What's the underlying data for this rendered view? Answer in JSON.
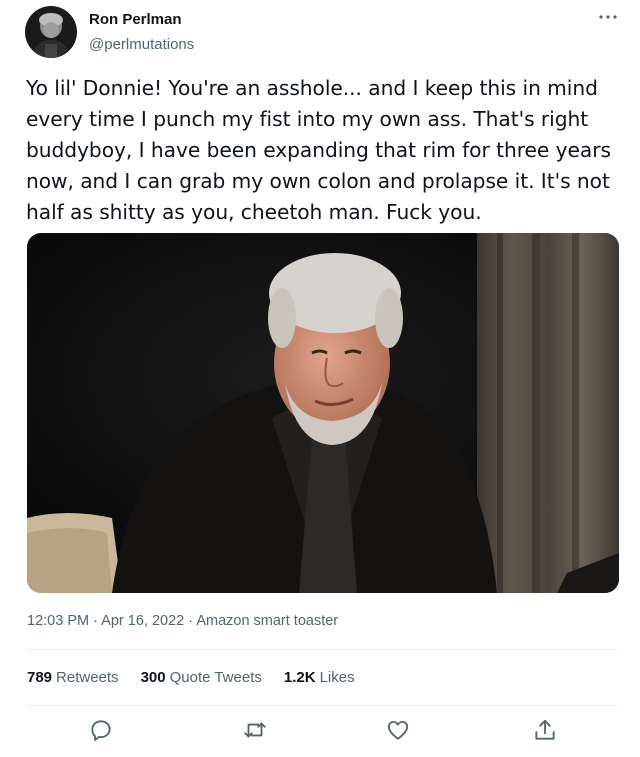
{
  "author": {
    "display_name": "Ron Perlman",
    "handle": "@perlmutations"
  },
  "tweet": {
    "text": "Yo lil' Donnie! You're an asshole... and I keep this in mind every time I punch my fist into my own ass. That's right buddyboy, I have been expanding that rim for three years now, and I can grab my own colon and prolapse it. It's not half as shitty as you, cheetoh man. Fuck you."
  },
  "meta": {
    "time": "12:03 PM",
    "date": "Apr 16, 2022",
    "separator": "·",
    "source": "Amazon smart toaster"
  },
  "stats": {
    "retweets": {
      "count": "789",
      "label": "Retweets"
    },
    "quote_tweets": {
      "count": "300",
      "label": "Quote Tweets"
    },
    "likes": {
      "count": "1.2K",
      "label": "Likes"
    }
  },
  "actions": [
    "reply-icon",
    "retweet-icon",
    "like-icon",
    "share-icon"
  ],
  "colors": {
    "text_primary": "#0f1419",
    "text_secondary": "#536471",
    "divider": "#e6ecf0",
    "action_icon": "#536471"
  }
}
